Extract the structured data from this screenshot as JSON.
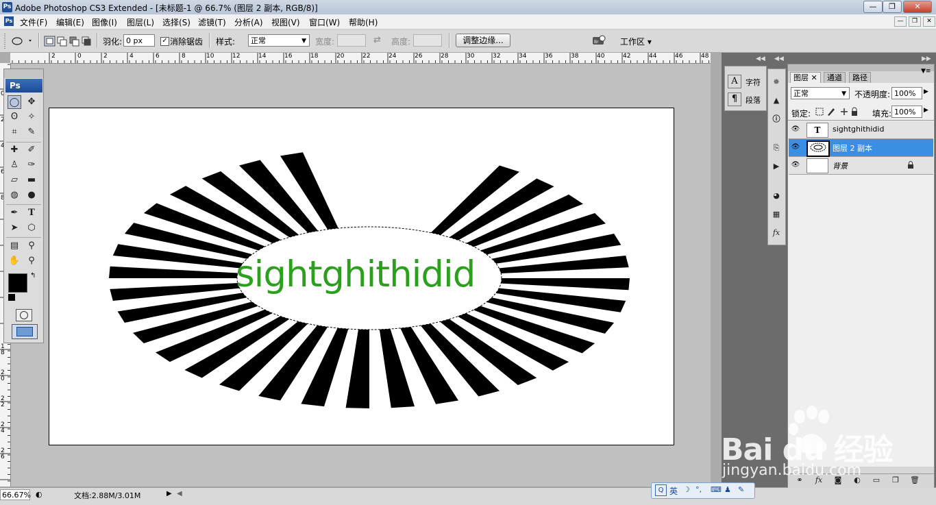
{
  "window": {
    "title": "Adobe Photoshop CS3 Extended - [未标题-1 @ 66.7% (图层 2 副本, RGB/8)]",
    "app_icon": "Ps",
    "controls": {
      "minimize": "—",
      "maximize": "❐",
      "close": "✕"
    }
  },
  "menubar": {
    "app_icon": "Ps",
    "items": [
      "文件(F)",
      "编辑(E)",
      "图像(I)",
      "图层(L)",
      "选择(S)",
      "滤镜(T)",
      "分析(A)",
      "视图(V)",
      "窗口(W)",
      "帮助(H)"
    ],
    "doc_controls": {
      "minimize": "—",
      "restore": "❐",
      "close": "✕"
    }
  },
  "options": {
    "feather_label": "羽化:",
    "feather_value": "0 px",
    "antialias_label": "消除锯齿",
    "antialias_checked": true,
    "style_label": "样式:",
    "style_value": "正常",
    "width_label": "宽度:",
    "height_label": "高度:",
    "refine_edge": "调整边缘...",
    "workspace": "工作区 ▾"
  },
  "ruler": {
    "top_labels": [
      "2",
      "0",
      "2",
      "4",
      "6",
      "8",
      "10",
      "12",
      "14",
      "16",
      "18",
      "20",
      "22",
      "24",
      "26",
      "28",
      "30",
      "32",
      "34",
      "36",
      "38",
      "40",
      "42",
      "44",
      "46",
      "48",
      "50"
    ],
    "left_labels": [
      "0",
      "2",
      "4",
      "6",
      "8",
      "1 0",
      "1 2",
      "1 4",
      "1 6",
      "1 8",
      "2 0",
      "2 2",
      "2 4",
      "2 6"
    ]
  },
  "canvas": {
    "text": "sightghithidid",
    "text_color": "#2aa01c",
    "ray_color": "#000000"
  },
  "toolbox": {
    "logo": "Ps"
  },
  "status": {
    "zoom": "66.67%",
    "doc_size": "文档:2.88M/3.01M"
  },
  "char_panel": {
    "items": [
      {
        "icon": "A",
        "label": "字符"
      },
      {
        "icon": "¶",
        "label": "段落"
      }
    ]
  },
  "layers_panel": {
    "tabs": [
      "图层",
      "通道",
      "路径"
    ],
    "blend_mode": "正常",
    "opacity_label": "不透明度:",
    "opacity_value": "100%",
    "lock_label": "锁定:",
    "fill_label": "填充:",
    "fill_value": "100%",
    "layers": [
      {
        "name": "sightghithidid",
        "thumb": "T",
        "selected": false
      },
      {
        "name": "图层 2 副本",
        "thumb": "",
        "selected": true
      },
      {
        "name": "背景",
        "thumb": "",
        "selected": false
      }
    ]
  },
  "ime": {
    "lang": "英"
  },
  "watermark": {
    "brand": "Bai du 经验",
    "url": "jingyan.baidu.com"
  }
}
